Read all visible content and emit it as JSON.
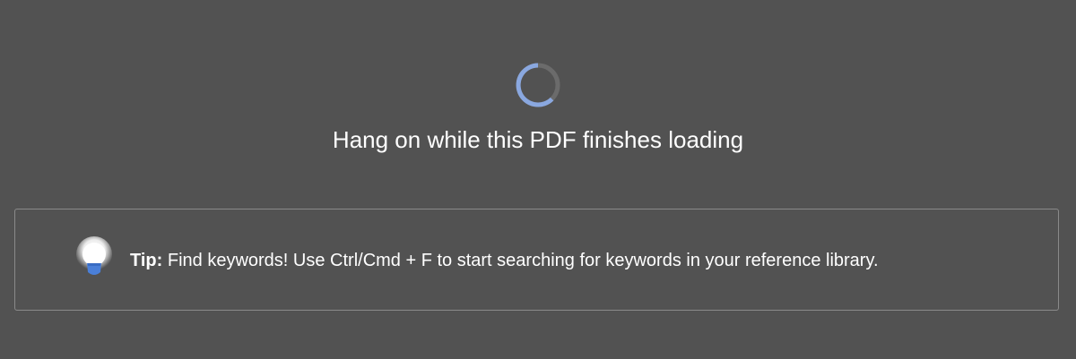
{
  "loading": {
    "message": "Hang on while this PDF finishes loading",
    "spinner_icon": "loading-spinner-icon",
    "spinner_color": "#8aa8e0",
    "spinner_track_color": "#6b6b6b"
  },
  "tip": {
    "label": "Tip:",
    "text": "Find keywords! Use Ctrl/Cmd + F to start searching for keywords in your reference library.",
    "icon": "lightbulb-icon",
    "icon_base_color": "#4a7fd8"
  },
  "colors": {
    "background": "#525252",
    "text": "#ffffff",
    "border": "#8a8a8a"
  }
}
